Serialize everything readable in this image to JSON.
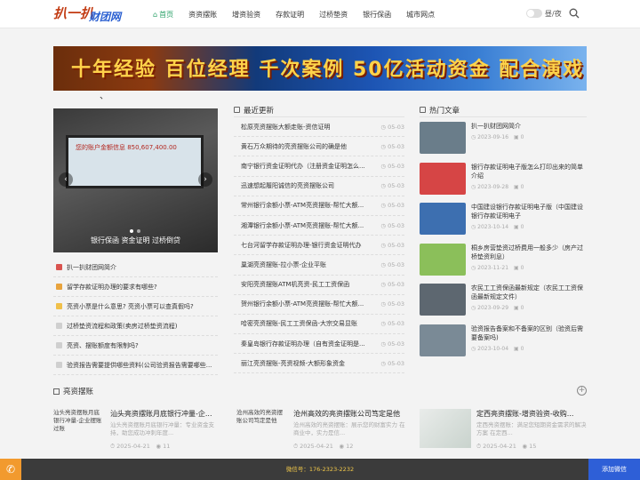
{
  "header": {
    "logo_part1": "扒一扒",
    "logo_part2": "财团网",
    "nav": [
      {
        "label": "首页",
        "icon": "home-icon",
        "active": true
      },
      {
        "label": "资资摆账"
      },
      {
        "label": "增资验资"
      },
      {
        "label": "存款证明"
      },
      {
        "label": "过桥垫资"
      },
      {
        "label": "银行保函"
      },
      {
        "label": "城市网点"
      }
    ],
    "theme_label": "昼/夜",
    "search_icon": "search-icon"
  },
  "banner": {
    "text": "十年经验 百位经理 千次案例 50亿活动资金 配合演戏"
  },
  "slider": {
    "caption": "银行保函 资金证明 过桥倒贷",
    "screen_text": "您的账户金额信息 850,607,400.00"
  },
  "left_list": [
    "扒一扒财团网简介",
    "留学存款证明办理的要求有哪些?",
    "亮资小票是什么意思? 亮资小票可以查真假吗?",
    "过桥垫资流程和政策(卖房过桥垫资流程)",
    "亮资、摆账额度有限制吗?",
    "验资报告需要提供哪些资料(公司验资报告需要哪些..."
  ],
  "recent": {
    "title": "最近更新",
    "items": [
      {
        "t": "松原亮资摆账大额走账-资信证明",
        "d": "05-03"
      },
      {
        "t": "黄石万众期待的亮资摆账公司的确是他",
        "d": "05-03"
      },
      {
        "t": "南宁银行资金证明代办（注册资金证明怎么...",
        "d": "05-03"
      },
      {
        "t": "迅速想起履阳诚信的亮资摆账公司",
        "d": "05-03"
      },
      {
        "t": "常州银行余额小票-ATM亮资摆账-帮忙大额...",
        "d": "05-03"
      },
      {
        "t": "湘潭银行余额小票-ATM亮资摆账-帮忙大额...",
        "d": "05-03"
      },
      {
        "t": "七台河留学存款证明办理-银行资金证明代办",
        "d": "05-03"
      },
      {
        "t": "巢湖亮资摆账-拉小票-企业平账",
        "d": "05-03"
      },
      {
        "t": "安阳亮资摆账ATM机亮资-民工工资保函",
        "d": "05-03"
      },
      {
        "t": "贺州银行余额小票-ATM亮资摆账-帮忙大额...",
        "d": "05-03"
      },
      {
        "t": "哈密亮资摆账-民工工资保函-大宗交易显账",
        "d": "05-03"
      },
      {
        "t": "秦皇岛银行存款证明办理（自有资金证明是...",
        "d": "05-03"
      },
      {
        "t": "丽江亮资摆账-亮资视频-大额形象资金",
        "d": "05-03"
      }
    ]
  },
  "hot": {
    "title": "热门文章",
    "items": [
      {
        "t": "扒一扒财团网简介",
        "date": "2023-09-16",
        "c": "0",
        "color": "#6a7d8a"
      },
      {
        "t": "银行存款证明电子版怎么打印出来的简单介绍",
        "date": "2023-09-28",
        "c": "0",
        "color": "#d64545"
      },
      {
        "t": "中国建设银行存款证明电子版（中国建设银行存款证明电子",
        "date": "2023-10-14",
        "c": "0",
        "color": "#3d6fb0"
      },
      {
        "t": "桐乡房营垫资过桥费用一般多少（房产过桥垫资利息）",
        "date": "2023-11-21",
        "c": "0",
        "color": "#8bbf5a"
      },
      {
        "t": "农民工工资保函最新规定（农民工工资保函最新规定文件）",
        "date": "2023-09-29",
        "c": "0",
        "color": "#5d6770"
      },
      {
        "t": "验资报告备案和不备案的区别（验资后需要备案吗)",
        "date": "2023-10-04",
        "c": "0",
        "color": "#7a8a96"
      }
    ]
  },
  "section2": {
    "title": "亮资摆账"
  },
  "cards": [
    {
      "thumb": "汕头亮资摆账月底银行冲量-企业摆账过账",
      "t": "汕头亮资摆账月底银行冲量-企...",
      "ds": "汕头亮资摆账月底银行冲量：专业资金支持，助您成功冲刺年度...",
      "date": "2025-04-21",
      "v": "11"
    },
    {
      "thumb": "沧州高效的亮资摆账公司笃定是他",
      "t": "沧州高效的亮资摆账公司笃定是他",
      "ds": "沧州高效的亮资摆账：展示您的财富实力 在商业中，实力是信...",
      "date": "2025-04-21",
      "v": "12"
    },
    {
      "thumb": "",
      "t": "定西亮资摆账-增资验资-收购...",
      "ds": "定西亮资摆账：满足您短期资金需求的解决方案 在定西...",
      "date": "2025-04-21",
      "v": "15"
    }
  ],
  "footer": {
    "text": "微信号：176-2323-2232",
    "wechat": "添加微信",
    "phone_icon": "phone-icon"
  }
}
